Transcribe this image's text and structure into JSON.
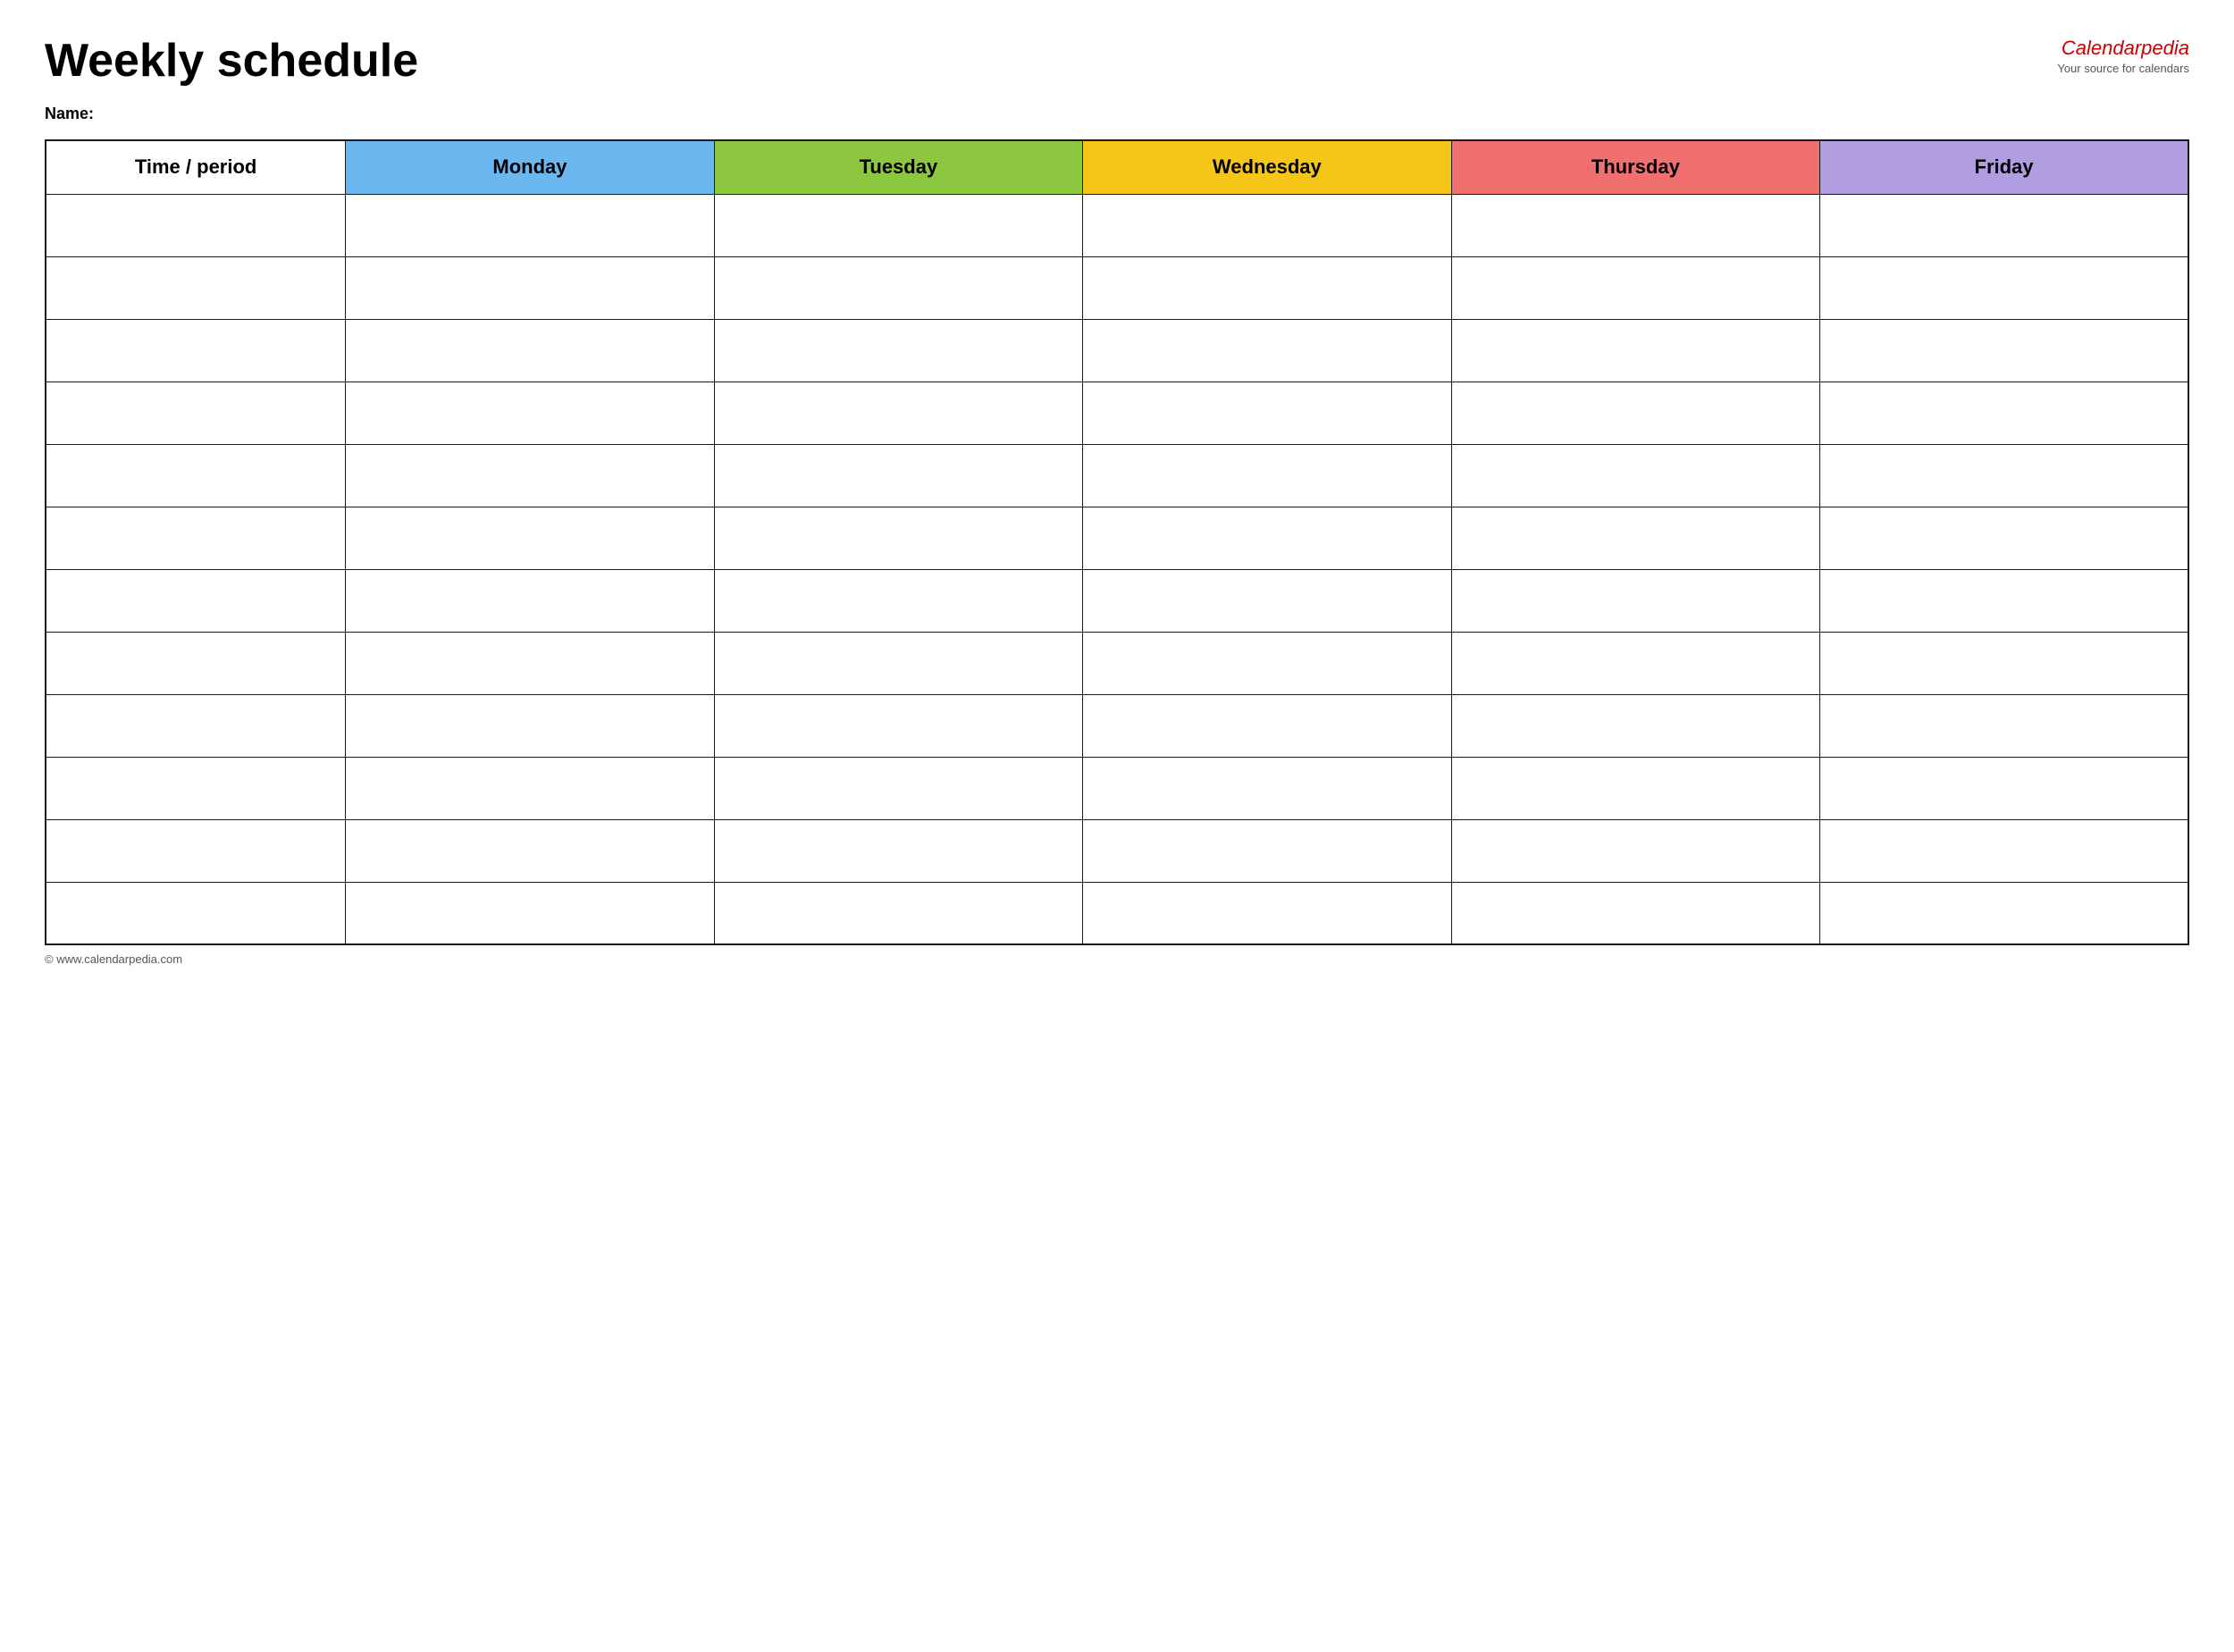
{
  "header": {
    "title": "Weekly schedule",
    "brand_name_part1": "Calendar",
    "brand_name_part2": "pedia",
    "brand_tagline": "Your source for calendars"
  },
  "name_section": {
    "label": "Name:"
  },
  "table": {
    "columns": [
      {
        "id": "time",
        "label": "Time / period",
        "color": "#ffffff"
      },
      {
        "id": "monday",
        "label": "Monday",
        "color": "#6bb8f0"
      },
      {
        "id": "tuesday",
        "label": "Tuesday",
        "color": "#8dc63f"
      },
      {
        "id": "wednesday",
        "label": "Wednesday",
        "color": "#f5c518"
      },
      {
        "id": "thursday",
        "label": "Thursday",
        "color": "#f07070"
      },
      {
        "id": "friday",
        "label": "Friday",
        "color": "#b09ee0"
      }
    ],
    "row_count": 12
  },
  "footer": {
    "copyright": "© www.calendarpedia.com"
  }
}
